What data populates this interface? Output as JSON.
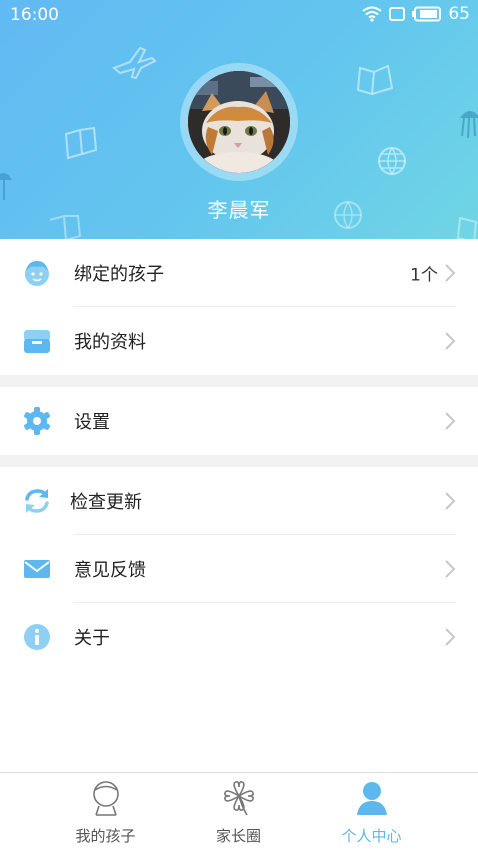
{
  "status_bar": {
    "time": "16:00",
    "battery": "65"
  },
  "profile": {
    "name": "李晨军"
  },
  "menu": {
    "section1": [
      {
        "label": "绑定的孩子",
        "value": "1个",
        "icon": "child-face-icon"
      },
      {
        "label": "我的资料",
        "icon": "profile-box-icon"
      }
    ],
    "section2": [
      {
        "label": "设置",
        "icon": "gear-icon"
      }
    ],
    "section3": [
      {
        "label": "检查更新",
        "icon": "refresh-icon"
      },
      {
        "label": "意见反馈",
        "icon": "mail-icon"
      },
      {
        "label": "关于",
        "icon": "info-icon"
      }
    ]
  },
  "tabs": [
    {
      "label": "我的孩子",
      "icon": "child-outline-icon"
    },
    {
      "label": "家长圈",
      "icon": "clover-icon"
    },
    {
      "label": "个人中心",
      "icon": "person-icon",
      "active": true
    }
  ],
  "colors": {
    "accent": "#5cb8ef",
    "header_start": "#62b9f3",
    "header_end": "#6fd6e4",
    "section_gap": "#f2f2f2"
  }
}
